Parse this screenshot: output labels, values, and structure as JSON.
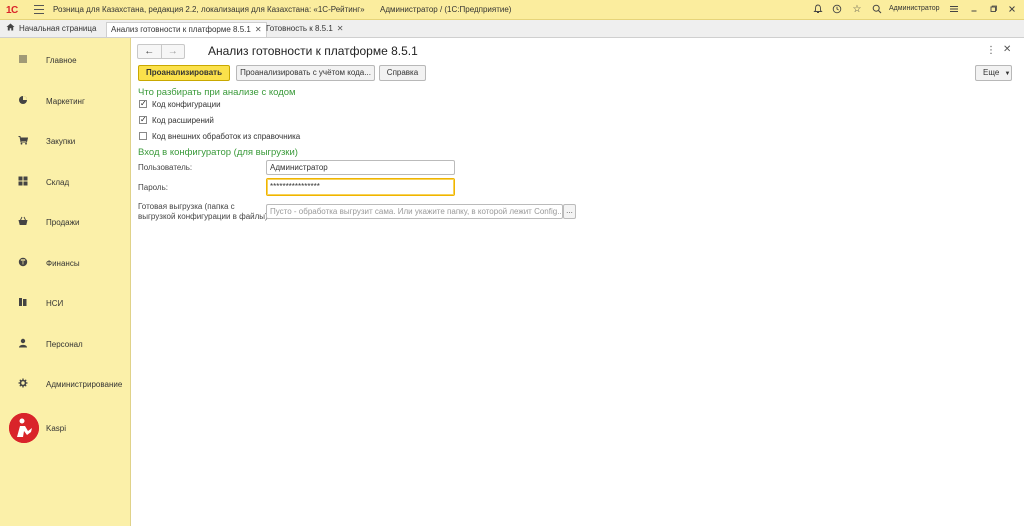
{
  "titlebar": {
    "logo": "1С",
    "app_title": "Розница для Казахстана, редакция 2.2, локализация для Казахстана: «1С-Рейтинг»",
    "user_title": "Администратор /  (1С:Предприятие)",
    "user_name": "Администратор",
    "icons": [
      "bell-icon",
      "history-icon",
      "star-icon",
      "search-icon",
      "settings-icon",
      "minimize-icon",
      "restore-icon",
      "close-icon"
    ]
  },
  "tabs": [
    {
      "label": "Начальная страница",
      "icon": "home-icon"
    },
    {
      "label": "Анализ готовности к платформе 8.5.1",
      "closable": true
    },
    {
      "label": "Готовность к 8.5.1",
      "closable": true
    }
  ],
  "sidebar": {
    "items": [
      {
        "label": "Главное",
        "icon": "list-icon"
      },
      {
        "label": "Маркетинг",
        "icon": "pie-chart-icon"
      },
      {
        "label": "Закупки",
        "icon": "cart-icon"
      },
      {
        "label": "Склад",
        "icon": "grid-icon"
      },
      {
        "label": "Продажи",
        "icon": "basket-icon"
      },
      {
        "label": "Финансы",
        "icon": "coins-icon"
      },
      {
        "label": "НСИ",
        "icon": "book-icon"
      },
      {
        "label": "Персонал",
        "icon": "person-icon"
      },
      {
        "label": "Администрирование",
        "icon": "gear-icon"
      },
      {
        "label": "Kaspi",
        "icon": "kaspi-logo-icon"
      }
    ]
  },
  "form": {
    "title": "Анализ готовности к платформе 8.5.1",
    "buttons": {
      "analyze": "Проанализировать",
      "analyze_code": "Проанализировать с учётом кода...",
      "help": "Справка",
      "more": "Еще"
    },
    "section1_title": "Что разбирать при анализе с кодом",
    "checks": [
      {
        "label": "Код конфигурации",
        "checked": true
      },
      {
        "label": "Код расширений",
        "checked": true
      },
      {
        "label": "Код внешних обработок из справочника",
        "checked": false
      }
    ],
    "section2_title": "Вход в конфигуратор (для выгрузки)",
    "user_label": "Пользователь:",
    "user_value": "Администратор",
    "password_label": "Пароль:",
    "password_value": "****************",
    "export_label_line1": "Готовая выгрузка (папка с",
    "export_label_line2": "выгрузкой конфигурации в файлы):",
    "export_placeholder": "Пусто - обработка выгрузит сама. Или укажите папку, в которой лежит Config...",
    "select_button": "..."
  }
}
